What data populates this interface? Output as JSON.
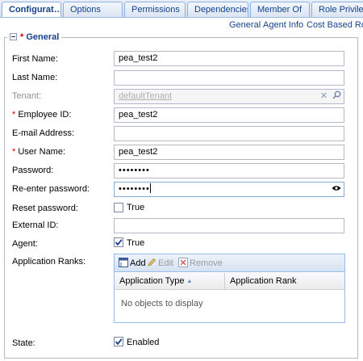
{
  "tabs": [
    {
      "label": "Configurat…",
      "active": true
    },
    {
      "label": "Options"
    },
    {
      "label": "Permissions"
    },
    {
      "label": "Dependencies"
    },
    {
      "label": "Member Of"
    },
    {
      "label": "Role Privileg…"
    }
  ],
  "subnav": [
    "General",
    "Agent Info",
    "Cost Based Rout"
  ],
  "section": {
    "required_mark": "*",
    "title": "General"
  },
  "form": {
    "first_name": {
      "label": "First Name:",
      "value": "pea_test2"
    },
    "last_name": {
      "label": "Last Name:",
      "value": ""
    },
    "tenant": {
      "label": "Tenant:",
      "value": "defaultTenant"
    },
    "employee_id": {
      "required_mark": "*",
      "label": "Employee ID:",
      "value": "pea_test2"
    },
    "email": {
      "label": "E-mail Address:",
      "value": ""
    },
    "user_name": {
      "required_mark": "*",
      "label": "User Name:",
      "value": "pea_test2"
    },
    "password": {
      "label": "Password:",
      "value": "••••••••"
    },
    "reenter_password": {
      "label": "Re-enter password:",
      "value": "••••••••"
    },
    "reset_password": {
      "label": "Reset password:",
      "checked": false,
      "option": "True"
    },
    "external_id": {
      "label": "External ID:",
      "value": ""
    },
    "agent": {
      "label": "Agent:",
      "checked": true,
      "option": "True"
    },
    "application_ranks": {
      "label": "Application Ranks:"
    },
    "state": {
      "label": "State:",
      "checked": true,
      "option": "Enabled"
    }
  },
  "grid": {
    "add_label": "Add",
    "edit_label": "Edit",
    "remove_label": "Remove",
    "columns": [
      "Application Type",
      "Application Rank"
    ],
    "sorted_column": "Application Type",
    "sort_direction": "ascending",
    "empty_text": "No objects to display"
  }
}
